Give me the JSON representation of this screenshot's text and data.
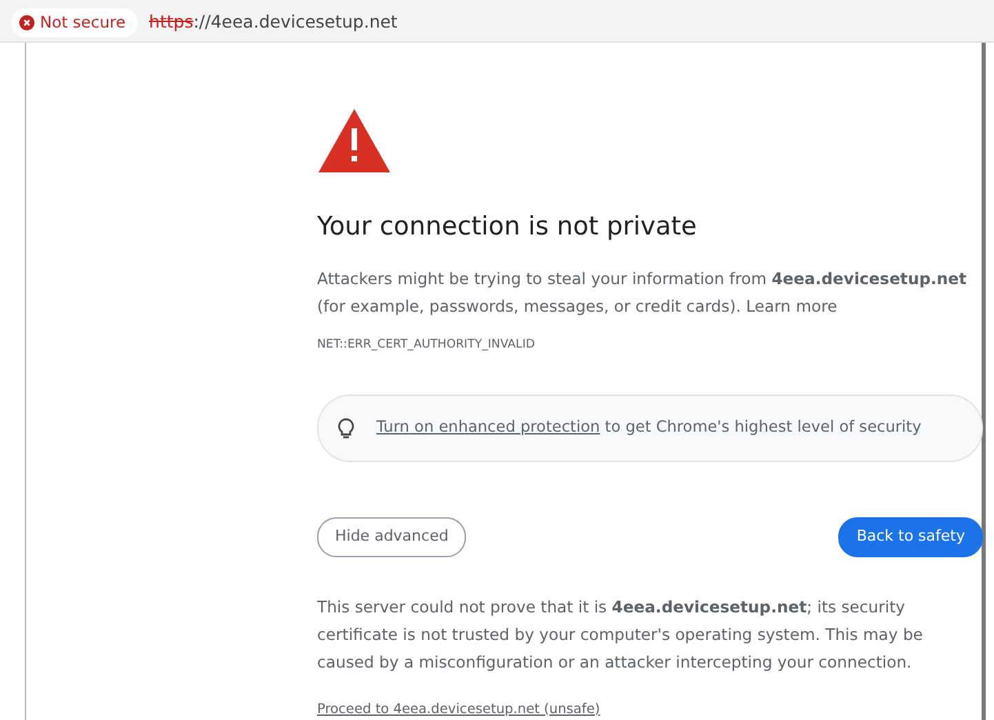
{
  "address_bar": {
    "security_chip": "Not secure",
    "url_scheme": "https",
    "url_rest": "://4eea.devicesetup.net"
  },
  "heading": "Your connection is not private",
  "intro": {
    "text": "Attackers might be trying to steal your information from **4eea.devicesetup.net** (for example, passwords, messages, or credit cards).",
    "link": "Learn more"
  },
  "error_code": "NET::ERR_CERT_AUTHORITY_INVALID",
  "protection_banner": {
    "link": "Turn on enhanced protection",
    "text": "to get Chrome's highest level of security"
  },
  "buttons": [
    {
      "label": "Hide advanced",
      "kind": "secondary"
    },
    {
      "label": "Back to safety",
      "kind": "primary"
    }
  ],
  "details": "This server could not prove that it is **4eea.devicesetup.net**; its security certificate is not trusted by your computer's operating system. This may be caused by a misconfiguration or an attacker intercepting your connection.",
  "proceed_link": "Proceed to 4eea.devicesetup.net (unsafe)"
}
